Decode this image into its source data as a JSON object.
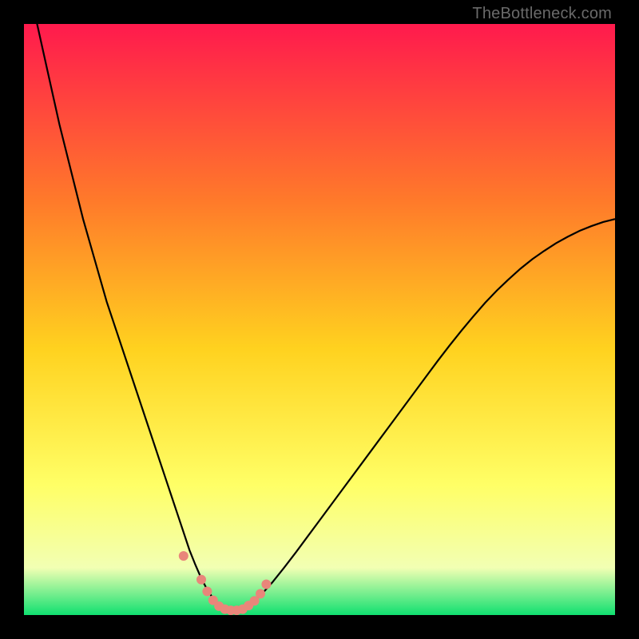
{
  "watermark": "TheBottleneck.com",
  "colors": {
    "frame": "#000000",
    "grad_top": "#ff1a4d",
    "grad_mid1": "#ff7a2a",
    "grad_mid2": "#ffd21f",
    "grad_mid3": "#ffff66",
    "grad_mid4": "#f2ffb3",
    "grad_bottom": "#10e070",
    "curve": "#000000",
    "markers": "#e9867a"
  },
  "chart_data": {
    "type": "line",
    "title": "",
    "xlabel": "",
    "ylabel": "",
    "xlim": [
      0,
      100
    ],
    "ylim": [
      0,
      100
    ],
    "x": [
      0,
      2,
      4,
      6,
      8,
      10,
      12,
      14,
      16,
      18,
      20,
      22,
      23,
      24,
      25,
      26,
      27,
      28,
      29,
      30,
      31,
      32,
      33,
      34,
      35,
      36,
      37,
      38,
      40,
      42,
      44,
      46,
      48,
      50,
      52,
      54,
      56,
      58,
      60,
      62,
      64,
      66,
      68,
      70,
      72,
      74,
      76,
      78,
      80,
      82,
      84,
      86,
      88,
      90,
      92,
      94,
      96,
      98,
      100
    ],
    "values": [
      110,
      101,
      92,
      83,
      75,
      67,
      60,
      53,
      47,
      41,
      35,
      29,
      26,
      23,
      20,
      17,
      14,
      11,
      8.5,
      6.2,
      4.3,
      2.8,
      1.7,
      1.0,
      0.7,
      0.7,
      1.0,
      1.6,
      3.3,
      5.5,
      8.0,
      10.6,
      13.3,
      16.0,
      18.7,
      21.4,
      24.1,
      26.8,
      29.5,
      32.2,
      34.9,
      37.6,
      40.3,
      43.0,
      45.6,
      48.1,
      50.5,
      52.8,
      54.9,
      56.8,
      58.6,
      60.2,
      61.6,
      62.9,
      64.0,
      65.0,
      65.8,
      66.5,
      67.0
    ],
    "markers": {
      "x": [
        27,
        30,
        31,
        32,
        33,
        34,
        35,
        36,
        37,
        38,
        39,
        40,
        41
      ],
      "y": [
        10.0,
        6.0,
        4.0,
        2.5,
        1.5,
        1.0,
        0.8,
        0.8,
        1.0,
        1.6,
        2.4,
        3.6,
        5.2
      ]
    }
  }
}
